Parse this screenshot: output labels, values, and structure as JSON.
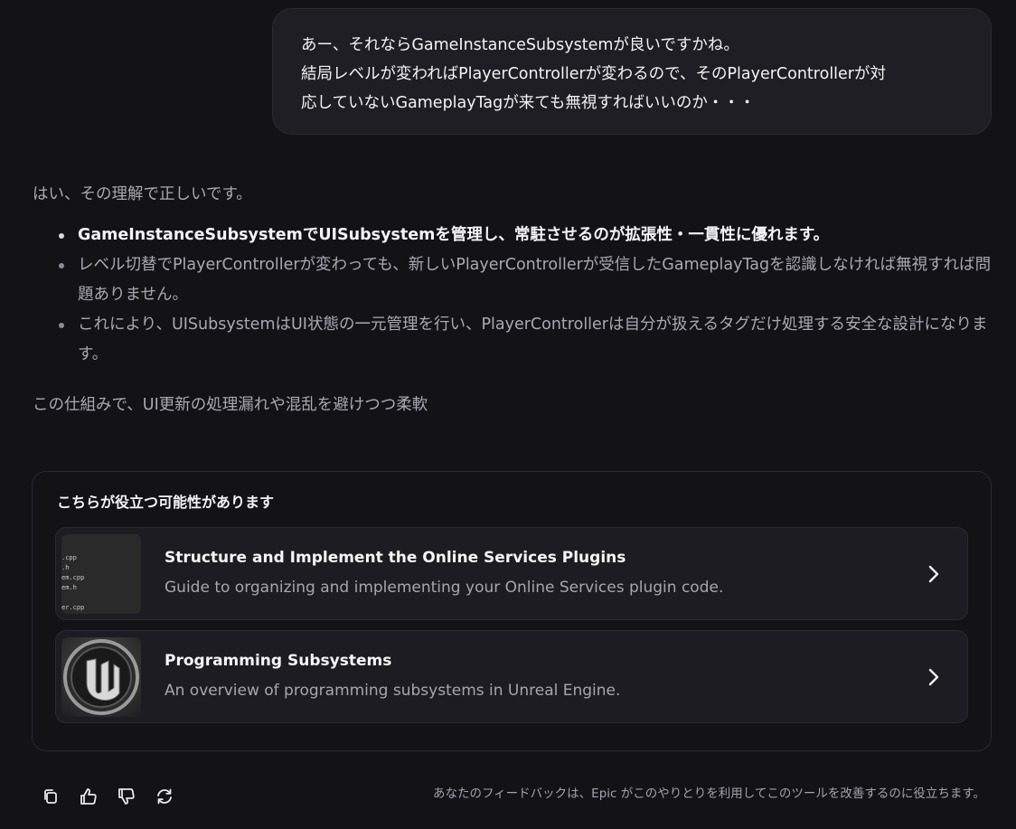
{
  "user_message": {
    "lines": [
      "あー、それならGameInstanceSubsystemが良いですかね。",
      "結局レベルが変わればPlayerControllerが変わるので、そのPlayerControllerが対",
      "応していないGameplayTagが来ても無視すればいいのか・・・"
    ]
  },
  "answer": {
    "intro": "はい、その理解で正しいです。",
    "bullets": [
      {
        "text": "GameInstanceSubsystemでUISubsystemを管理し、常駐させるのが拡張性・一貫性に優れます。",
        "bold": true
      },
      {
        "text": "レベル切替でPlayerControllerが変わっても、新しいPlayerControllerが受信したGameplayTagを認識しなければ無視すれば問題ありません。",
        "bold": false
      },
      {
        "text": "これにより、UISubsystemはUI状態の一元管理を行い、PlayerControllerは自分が扱えるタグだけ処理する安全な設計になります。",
        "bold": false
      }
    ],
    "outro": "この仕組みで、UI更新の処理漏れや混乱を避けつつ柔軟"
  },
  "suggestions": {
    "title": "こちらが役立つ可能性があります",
    "cards": [
      {
        "title": "Structure and Implement the Online Services Plugins",
        "description": "Guide to organizing and implementing your Online Services plugin code.",
        "thumb_lines": [
          ".cpp",
          ".h",
          "em.cpp",
          "em.h",
          "",
          "er.cpp"
        ],
        "thumb_icon": "code-files-thumbnail",
        "chevron_icon": "chevron-right-icon"
      },
      {
        "title": "Programming Subsystems",
        "description": "An overview of programming subsystems in Unreal Engine.",
        "thumb_icon": "unreal-engine-logo",
        "chevron_icon": "chevron-right-icon"
      }
    ]
  },
  "footer": {
    "actions": [
      "copy-icon",
      "thumbs-up-icon",
      "thumbs-down-icon",
      "regenerate-icon"
    ],
    "note": "あなたのフィードバックは、Epic がこのやりとりを利用してこのツールを改善するのに役立ちます。"
  },
  "colors": {
    "background": "#131217",
    "bubble": "#1f1e24",
    "card": "#1d1c22",
    "text_primary": "#f4f4f7",
    "text_secondary": "#a9a9b2"
  }
}
